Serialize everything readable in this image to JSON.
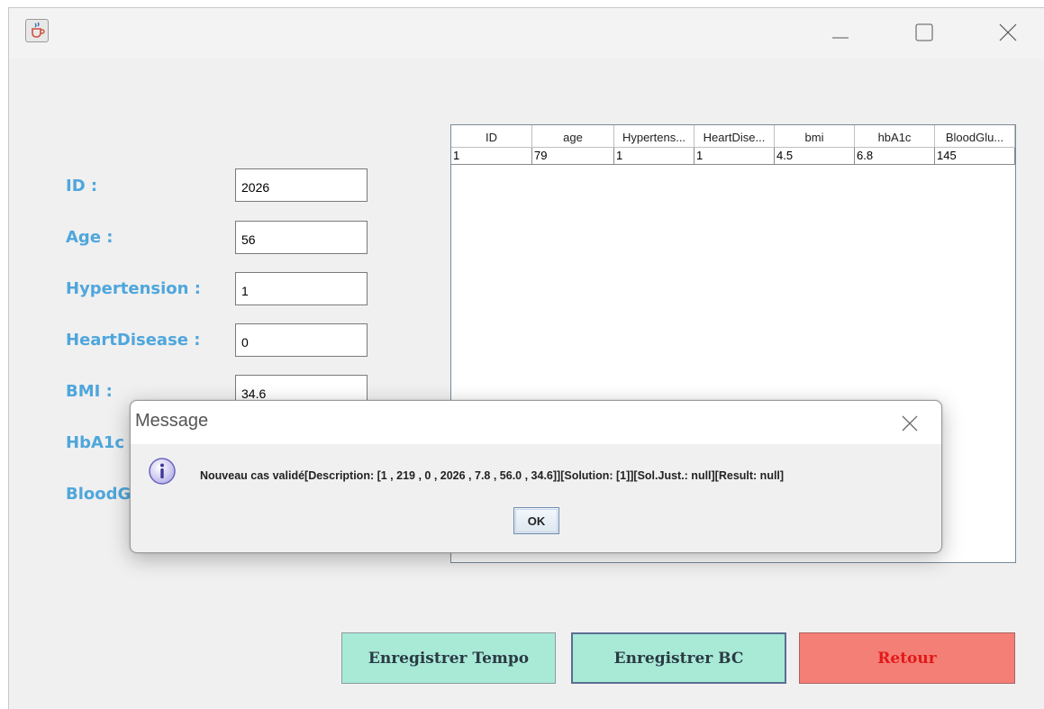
{
  "window": {
    "app_icon": "java-coffee-icon",
    "controls": {
      "minimize_icon": "minimize-icon",
      "maximize_icon": "maximize-icon",
      "close_icon": "close-icon"
    }
  },
  "form": {
    "fields": [
      {
        "label": "ID :",
        "value": "2026"
      },
      {
        "label": "Age :",
        "value": "56"
      },
      {
        "label": "Hypertension :",
        "value": "1"
      },
      {
        "label": "HeartDisease :",
        "value": "0"
      },
      {
        "label": "BMI :",
        "value": "34.6"
      },
      {
        "label": "HbA1c",
        "value": ""
      },
      {
        "label": "BloodG",
        "value": ""
      }
    ]
  },
  "table": {
    "columns": [
      "ID",
      "age",
      "Hypertens...",
      "HeartDise...",
      "bmi",
      "hbA1c",
      "BloodGlu..."
    ],
    "rows": [
      [
        "1",
        "79",
        "1",
        "1",
        "4.5",
        "6.8",
        "145"
      ]
    ]
  },
  "buttons": {
    "tempo": "Enregistrer Tempo",
    "bc": "Enregistrer BC",
    "retour": "Retour"
  },
  "dialog": {
    "title": "Message",
    "icon": "info-icon",
    "message": "Nouveau cas validé[Description: [1 , 219 , 0 , 2026 , 7.8 , 56.0 , 34.6]][Solution: [1]][Sol.Just.: null][Result: null]",
    "ok": "OK"
  },
  "colors": {
    "label_blue": "#4fa6dc",
    "button_mint": "#a9ead7",
    "button_red": "#f47f76",
    "retour_text": "#e21a1a"
  }
}
